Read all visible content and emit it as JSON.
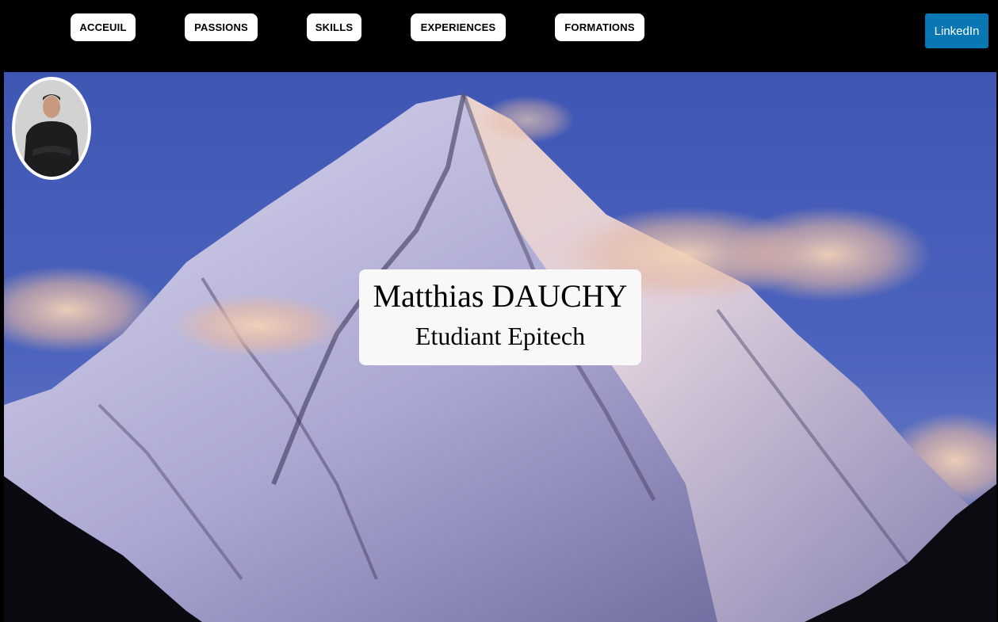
{
  "nav": {
    "items": [
      {
        "id": "acceuil",
        "label": "ACCEUIL"
      },
      {
        "id": "passions",
        "label": "PASSIONS"
      },
      {
        "id": "skills",
        "label": "SKILLS"
      },
      {
        "id": "experiences",
        "label": "EXPERIENCES"
      },
      {
        "id": "formations",
        "label": "FORMATIONS"
      }
    ],
    "linkedin_label": "LinkedIn"
  },
  "hero": {
    "name": "Matthias DAUCHY",
    "subtitle": "Etudiant Epitech",
    "background": "mountain-photo",
    "avatar": "profile-photo"
  },
  "colors": {
    "page_background": "#000000",
    "linkedin": "#0a77b5",
    "sky": "#3c55b0",
    "nav_button": "#ffffff",
    "card": "#f8f8f8"
  }
}
